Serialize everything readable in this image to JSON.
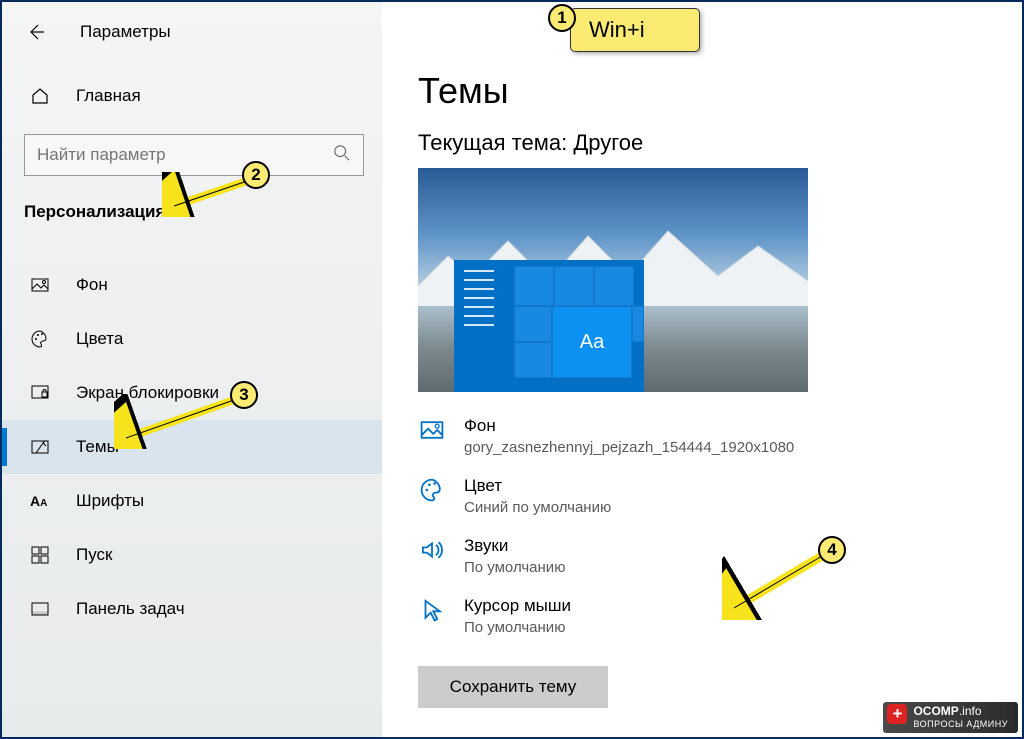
{
  "header": {
    "title": "Параметры"
  },
  "home_label": "Главная",
  "search": {
    "placeholder": "Найти параметр"
  },
  "category": "Персонализация",
  "sidebar": {
    "items": [
      {
        "label": "Фон"
      },
      {
        "label": "Цвета"
      },
      {
        "label": "Экран блокировки"
      },
      {
        "label": "Темы"
      },
      {
        "label": "Шрифты"
      },
      {
        "label": "Пуск"
      },
      {
        "label": "Панель задач"
      }
    ]
  },
  "main": {
    "title": "Темы",
    "current_theme_label": "Текущая тема: Другое",
    "preview_tile_text": "Aa",
    "options": [
      {
        "title": "Фон",
        "value": "gory_zasnezhennyj_pejzazh_154444_1920x1080"
      },
      {
        "title": "Цвет",
        "value": "Синий по умолчанию"
      },
      {
        "title": "Звуки",
        "value": "По умолчанию"
      },
      {
        "title": "Курсор мыши",
        "value": "По умолчанию"
      }
    ],
    "save_button": "Сохранить тему"
  },
  "annotations": {
    "note1": "Win+i",
    "b1": "1",
    "b2": "2",
    "b3": "3",
    "b4": "4"
  },
  "watermark": {
    "brand": "OCOMP",
    "tld": ".info",
    "sub": "ВОПРОСЫ АДМИНУ"
  }
}
